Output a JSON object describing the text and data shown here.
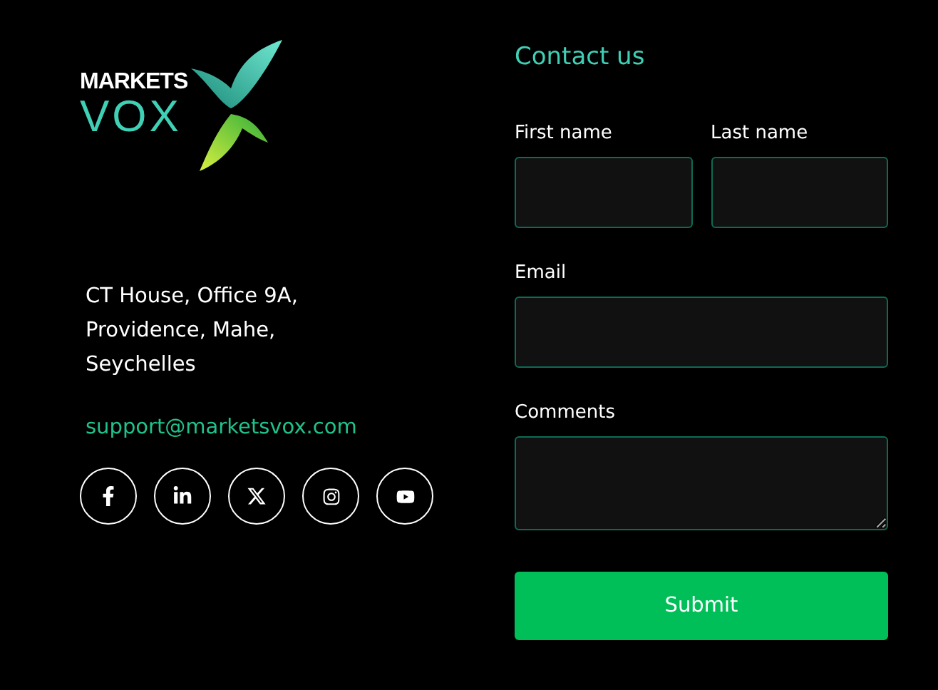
{
  "brand": {
    "top": "MARKETS",
    "bottom": "VOX"
  },
  "address": "CT House, Office 9A,\nProvidence, Mahe,\nSeychelles",
  "email": "support@marketsvox.com",
  "socials": [
    {
      "kind": "facebook"
    },
    {
      "kind": "linkedin"
    },
    {
      "kind": "x"
    },
    {
      "kind": "instagram"
    },
    {
      "kind": "youtube"
    }
  ],
  "form": {
    "title": "Contact us",
    "rows": [
      [
        {
          "label": "First name",
          "kind": "input"
        },
        {
          "label": "Last name",
          "kind": "input"
        }
      ],
      [
        {
          "label": "Email",
          "kind": "input"
        }
      ],
      [
        {
          "label": "Comments",
          "kind": "textarea"
        }
      ]
    ],
    "submit": "Submit"
  }
}
